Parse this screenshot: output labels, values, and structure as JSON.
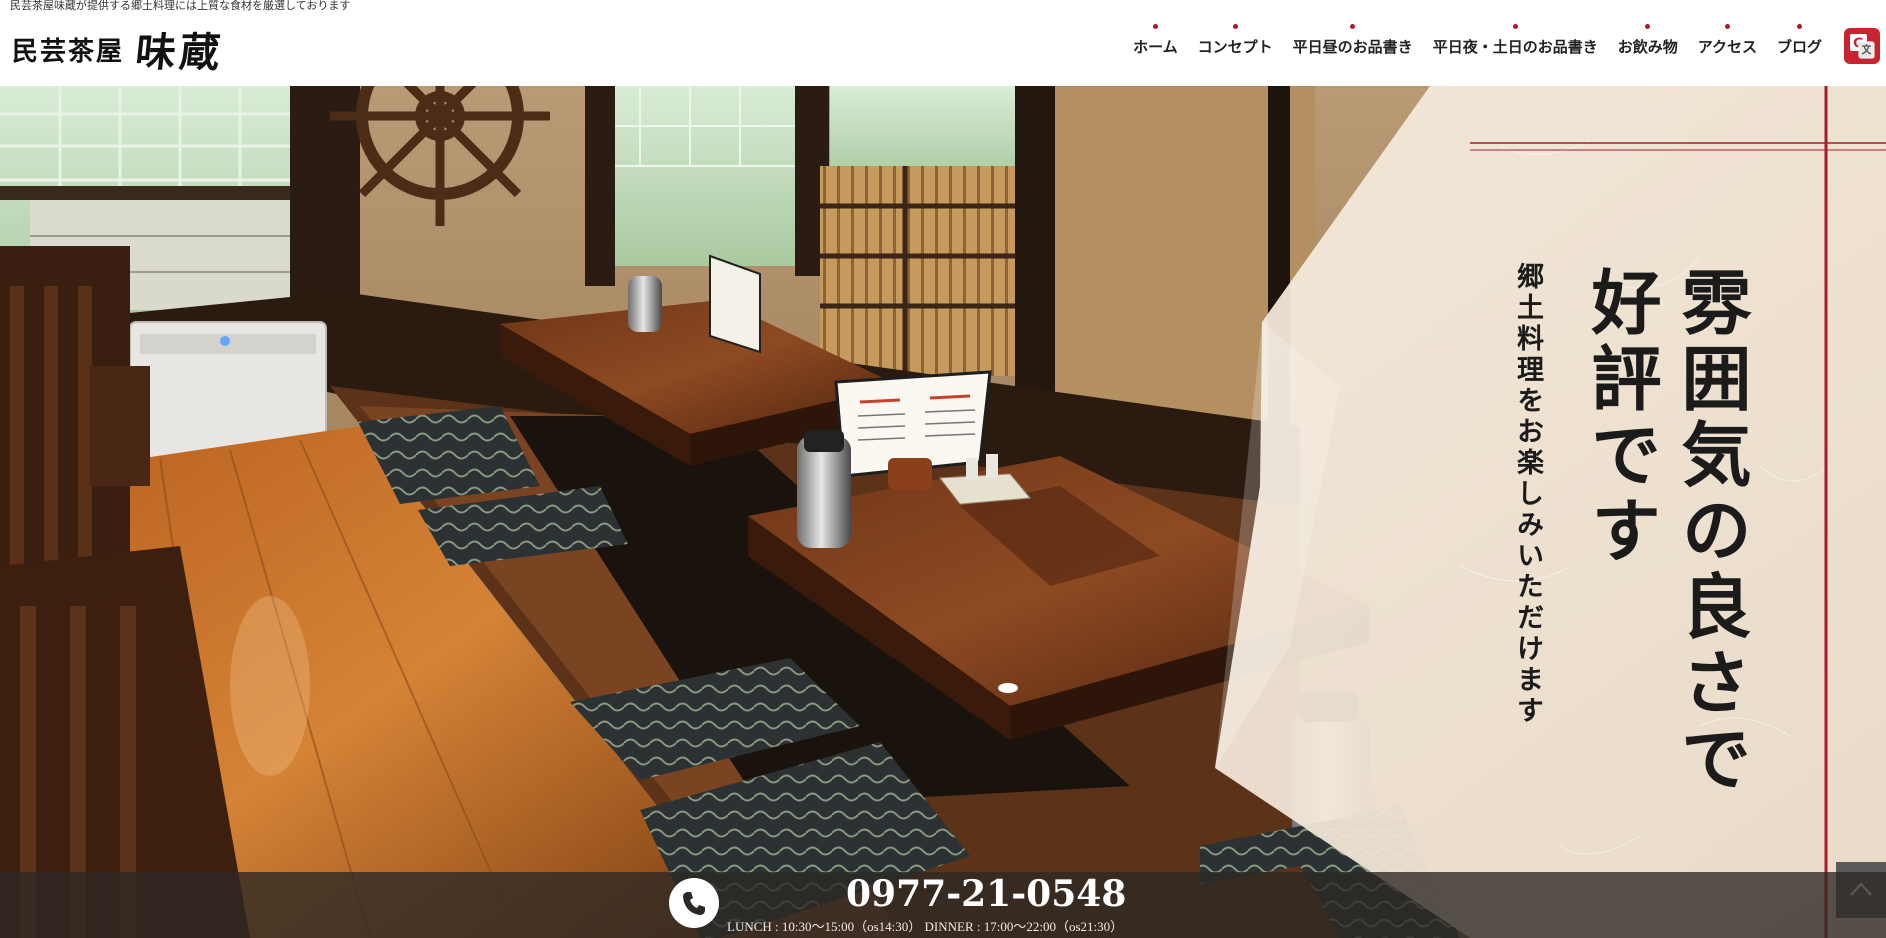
{
  "header": {
    "tagline": "民芸茶屋味蔵が提供する郷土料理には上質な食材を厳選しております",
    "logo_small": "民芸茶屋",
    "logo_big": "味蔵",
    "nav": [
      {
        "label": "ホーム"
      },
      {
        "label": "コンセプト"
      },
      {
        "label": "平日昼のお品書き"
      },
      {
        "label": "平日夜・土日のお品書き"
      },
      {
        "label": "お飲み物"
      },
      {
        "label": "アクセス"
      },
      {
        "label": "ブログ"
      }
    ],
    "translate_icon": "google-translate-icon"
  },
  "hero": {
    "title_line1": "雰囲気の良さで",
    "title_line2": "好評です",
    "subtitle": "郷土料理をお楽しみいただけます",
    "scroll_top_icon": "chevron-up-icon"
  },
  "contact": {
    "phone_icon": "phone-icon",
    "phone": "0977-21-0548",
    "hours": "LUNCH : 10:30〜15:00（os14:30） DINNER : 17:00〜22:00（os21:30）"
  },
  "colors": {
    "accent": "#b3172a",
    "washi": "#f3e9dc",
    "wood": "#5a2f1a",
    "bar": "#2d2824"
  }
}
